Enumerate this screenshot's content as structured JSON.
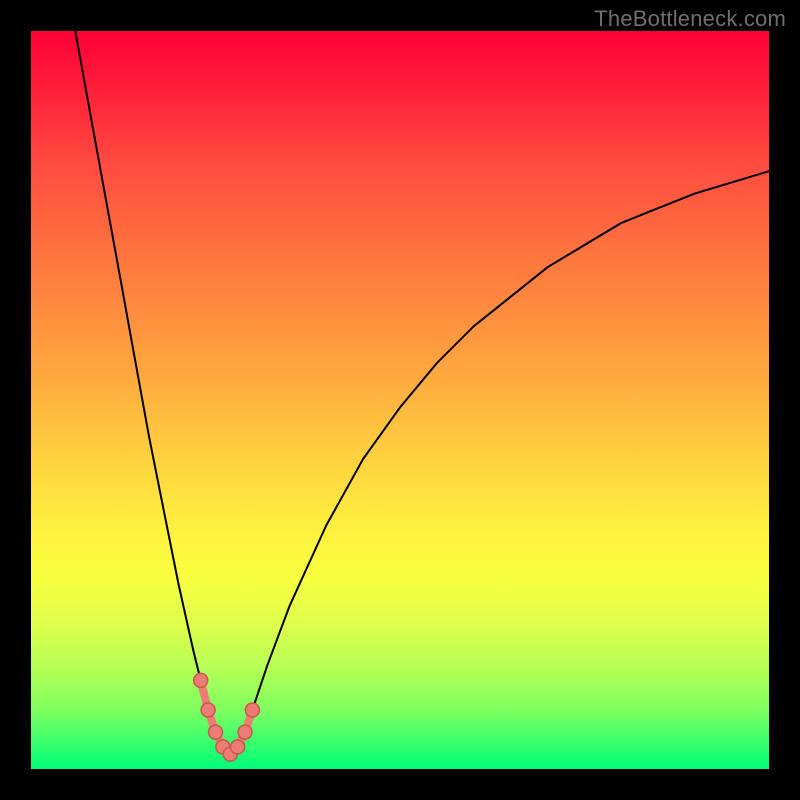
{
  "watermark": "TheBottleneck.com",
  "colors": {
    "frame": "#000000",
    "curve": "#000000",
    "marker": "#ed7d74",
    "marker_edge": "#c9554d",
    "gradient_top": "#ff0036",
    "gradient_bottom": "#00ff7a"
  },
  "chart_data": {
    "type": "line",
    "title": "",
    "xlabel": "",
    "ylabel": "",
    "xlim": [
      0,
      100
    ],
    "ylim": [
      0,
      100
    ],
    "grid": false,
    "legend": false,
    "series": [
      {
        "name": "bottleneck-curve",
        "x": [
          6,
          8,
          10,
          12,
          14,
          16,
          18,
          20,
          22,
          23,
          24,
          25,
          26,
          27,
          28,
          29,
          30,
          32,
          35,
          40,
          45,
          50,
          55,
          60,
          65,
          70,
          75,
          80,
          85,
          90,
          95,
          100
        ],
        "y": [
          100,
          89,
          78,
          67,
          56,
          45,
          35,
          25,
          16,
          12,
          8,
          5,
          3,
          2,
          3,
          5,
          8,
          14,
          22,
          33,
          42,
          49,
          55,
          60,
          64,
          68,
          71,
          74,
          76,
          78,
          79.5,
          81
        ]
      }
    ],
    "markers": {
      "name": "optimal-range",
      "x": [
        23,
        24,
        25,
        26,
        27,
        28,
        29,
        30
      ],
      "y": [
        12,
        8,
        5,
        3,
        2,
        3,
        5,
        8
      ]
    },
    "annotations": []
  }
}
